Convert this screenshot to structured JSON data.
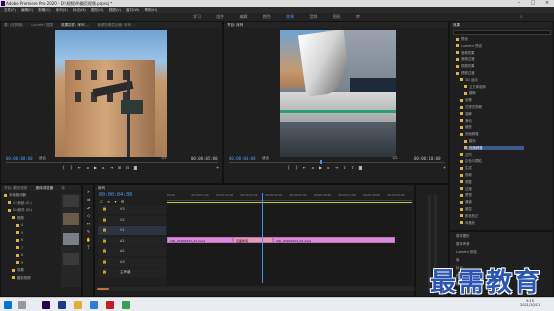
{
  "window": {
    "title": "Adobe Premiere Pro 2020 - D:\\视频\\9\\翻页视频.prproj *"
  },
  "menu": [
    "文件(F)",
    "编辑(E)",
    "剪辑(C)",
    "序列(S)",
    "标记(M)",
    "图形(G)",
    "视图(V)",
    "窗口(W)",
    "帮助(H)"
  ],
  "workspace_tabs": [
    "学习",
    "组件",
    "编辑",
    "颜色",
    "效果",
    "音频",
    "图形",
    "库"
  ],
  "workspace_active": "效果",
  "source_panel": {
    "tabs": [
      "源: (无剪辑)",
      "Lumetri 范围",
      "效果控件: 序列 ...",
      "音频剪辑混合器: 序列 ..."
    ],
    "timecode_left": "00:00:00:00",
    "fit": "适合",
    "ratio": "1/2",
    "timecode_right": "00:00:05:00"
  },
  "program_panel": {
    "tabs": [
      "节目: 序列"
    ],
    "timecode_left": "00:00:04:08",
    "fit": "适合",
    "ratio": "1/2",
    "timecode_right": "00:00:10:00"
  },
  "effects_panel": {
    "title": "效果",
    "items": [
      "预设",
      "Lumetri 预设",
      "音频效果",
      "音频过渡",
      "视频效果",
      "视频过渡",
      "3D 运动",
      "立方体旋转",
      "翻转",
      "划像",
      "沉浸式视频",
      "溶解",
      "滑动",
      "缩放",
      "页面剥落",
      "翻页",
      "页面剥落",
      "过时",
      "杂色与颗粒",
      "生成",
      "视频",
      "调整",
      "过渡",
      "透视",
      "通道",
      "键控",
      "颜色校正",
      "风格化"
    ]
  },
  "essential": {
    "items": [
      "基本图形",
      "基本声音",
      "Lumetri 颜色",
      "库",
      "标记",
      "历史记录",
      "信息"
    ]
  },
  "project_panel": {
    "tabs": [
      "项目: 翻页视频",
      "媒体浏览器",
      "库",
      "信息"
    ],
    "items": [
      "本地驱动器",
      "C:\\系统 (C:)",
      "D:\\软件 (D:)",
      "视频",
      "4",
      "5",
      "6",
      "7",
      "8",
      "9",
      "效果",
      "翻页视频"
    ]
  },
  "timeline": {
    "title": "序列",
    "timecode": "00:00:04:08",
    "ruler": [
      "00:00",
      "00:00:01:00",
      "00:00:02:00",
      "00:00:03:00",
      "00:00:04:00",
      "00:00:05:00",
      "00:00:06:00",
      "00:00:07:00",
      "00:00:08:00",
      "00:00:09:00"
    ],
    "tracks": [
      "V3",
      "V2",
      "V1",
      "A1",
      "A2",
      "A3",
      "主声道"
    ],
    "clip1": "VID_20200923_01.mp4",
    "transition": "页面剥落",
    "clip2": "VID_20200923_02.mp4"
  },
  "taskbar": {
    "time": "9:15",
    "date": "2021/10/11"
  },
  "watermark": "最需教育"
}
